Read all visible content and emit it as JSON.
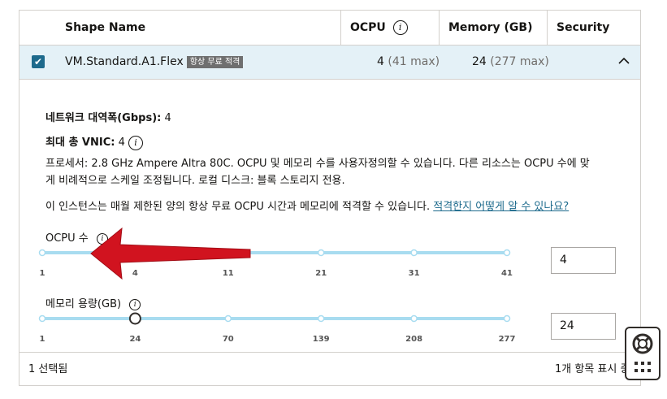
{
  "table": {
    "headers": {
      "shape_name": "Shape Name",
      "ocpu": "OCPU",
      "memory": "Memory (GB)",
      "security": "Security"
    },
    "row": {
      "name": "VM.Standard.A1.Flex",
      "badge": "항상 무료 적격",
      "ocpu": "4",
      "ocpu_max": "(41 max)",
      "memory": "24",
      "memory_max": "(277 max)",
      "selected": true
    }
  },
  "details": {
    "bandwidth_label": "네트워크 대역폭(Gbps):",
    "bandwidth_value": "4",
    "vnic_label": "최대 총 VNIC:",
    "vnic_value": "4",
    "processor_line1": "프로세서: 2.8 GHz Ampere Altra 80C. OCPU 및 메모리 수를 사용자정의할 수 있습니다. 다른 리소스는 OCPU 수에 맞",
    "processor_line2": "게 비례적으로 스케일 조정됩니다. 로컬 디스크: 블록 스토리지 전용.",
    "free_tier_text": "이 인스턴스는 매월 제한된 양의 항상 무료 OCPU 시간과 메모리에 적격할 수 있습니다.",
    "free_tier_link": "적격한지 어떻게 알 수 있나요?"
  },
  "ocpu_slider": {
    "label": "OCPU 수",
    "ticks": [
      "1",
      "4",
      "11",
      "21",
      "31",
      "41"
    ],
    "value": 4,
    "input_value": "4"
  },
  "memory_slider": {
    "label": "메모리 용량(GB)",
    "ticks": [
      "1",
      "24",
      "70",
      "139",
      "208",
      "277"
    ],
    "value": 24,
    "input_value": "24"
  },
  "footer": {
    "selected_text": "1 선택됨",
    "right_text": "1개 항목 표시 중"
  },
  "icons": {
    "info": "info-icon",
    "checkbox": "checkmark-icon",
    "chevron": "chevron-up-icon",
    "arrow": "red-arrow-annotation",
    "help": "lifebuoy-icon",
    "grid": "grid-dots-icon"
  },
  "colors": {
    "accent": "#1d6a8c",
    "selected_row": "#e4f1f7",
    "slider_track": "#a8dcf0",
    "arrow": "#d1131f"
  }
}
